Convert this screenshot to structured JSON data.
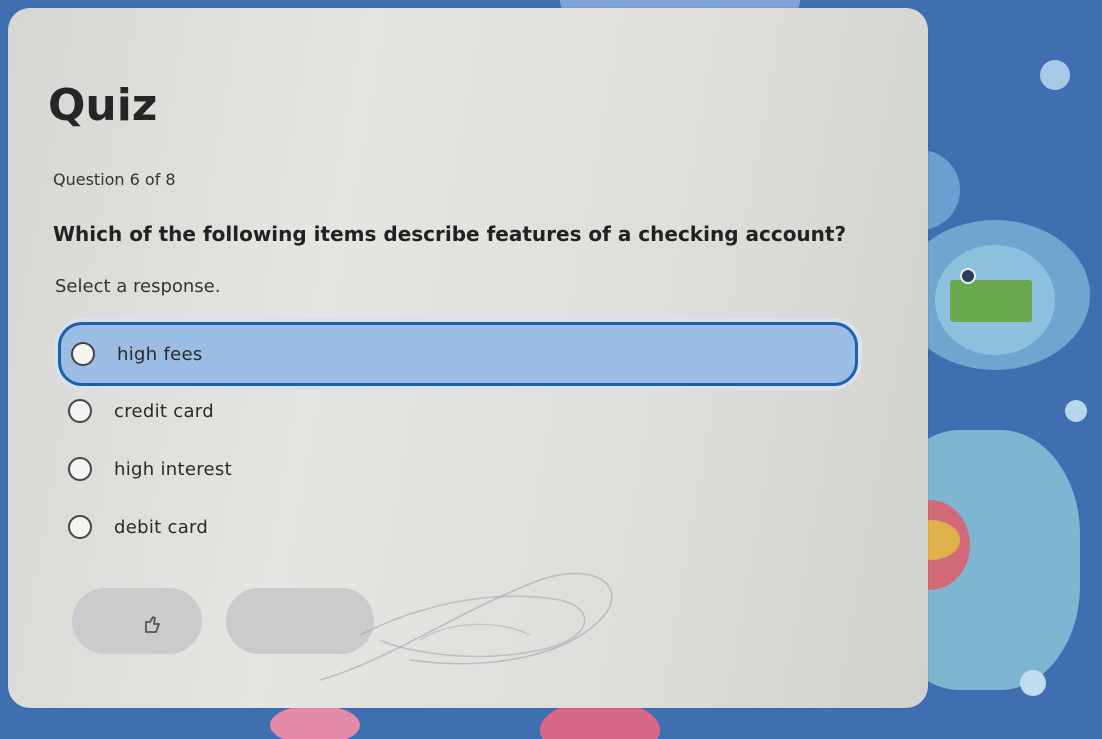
{
  "quiz": {
    "title": "Quiz",
    "counter": "Question 6 of 8",
    "question": "Which of the following items describe features of a checking account?",
    "instruction": "Select a response.",
    "options": [
      {
        "label": "high fees",
        "selected": true
      },
      {
        "label": "credit card",
        "selected": false
      },
      {
        "label": "high interest",
        "selected": false
      },
      {
        "label": "debit card",
        "selected": false
      }
    ]
  },
  "buttons": {
    "check_icon": "thumb-icon",
    "next_icon": "none"
  },
  "colors": {
    "selected_bg": "#9bbde4",
    "selected_border": "#1f5fb0",
    "panel_bg": "#e2e2df",
    "page_bg": "#3f6fb0"
  }
}
